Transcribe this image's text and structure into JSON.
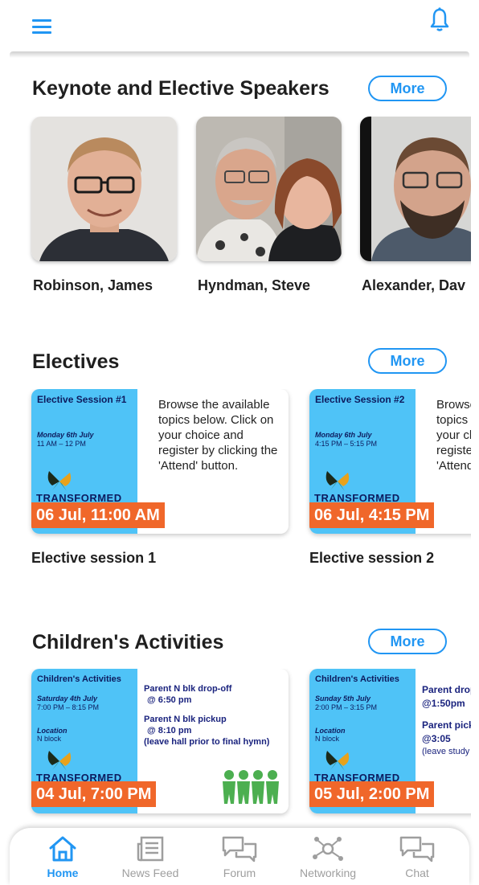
{
  "header": {
    "menu_icon": "hamburger-menu-icon",
    "notification_icon": "bell-icon",
    "accent_color": "#2196f3"
  },
  "speakers": {
    "title": "Keynote and Elective Speakers",
    "more_label": "More",
    "items": [
      {
        "name": "Robinson, James"
      },
      {
        "name": "Hyndman, Steve"
      },
      {
        "name": "Alexander, Dav"
      }
    ]
  },
  "electives": {
    "title": "Electives",
    "more_label": "More",
    "items": [
      {
        "banner_title": "Elective Session #1",
        "banner_day": "Monday 6th July",
        "banner_time": "11 AM – 12 PM",
        "brand": "TRANSFORMED",
        "description": "Browse the available topics below. Click on your choice and register by clicking the 'Attend' button.",
        "date_badge": "06 Jul, 11:00 AM",
        "title": "Elective session 1"
      },
      {
        "banner_title": "Elective Session #2",
        "banner_day": "Monday 6th July",
        "banner_time": "4:15 PM – 5:15 PM",
        "brand": "TRANSFORMED",
        "description": "Browse the available topics below. Click on your choice and register by clicking the 'Attend' button.",
        "date_badge": "06 Jul, 4:15 PM",
        "title": "Elective session 2"
      }
    ]
  },
  "children": {
    "title": "Children's Activities",
    "more_label": "More",
    "items": [
      {
        "banner_title": "Children's Activities",
        "banner_day": "Saturday 4th July",
        "banner_time": "7:00 PM – 8:15 PM",
        "location_label": "Location",
        "location_value": "N block",
        "brand": "TRANSFORMED",
        "line1": "Parent N blk drop-off",
        "line2": "@ 6:50 pm",
        "line3": "Parent N blk pickup",
        "line4": "@ 8:10 pm",
        "line5": "(leave hall prior to final hymn)",
        "date_badge": "04 Jul, 7:00 PM"
      },
      {
        "banner_title": "Children's Activities",
        "banner_day": "Sunday 5th July",
        "banner_time": "2:00 PM – 3:15 PM",
        "location_label": "Location",
        "location_value": "N block",
        "brand": "TRANSFORMED",
        "line1": "Parent drop-off",
        "line2": "@1:50pm",
        "line3": "Parent pickup",
        "line4": "@3:05",
        "line5": "(leave study prior to final hymn)",
        "date_badge": "05 Jul, 2:00 PM"
      }
    ]
  },
  "tabbar": {
    "active_color": "#2196f3",
    "inactive_color": "#9e9e9e",
    "tabs": [
      {
        "label": "Home",
        "icon": "home-icon"
      },
      {
        "label": "News Feed",
        "icon": "newspaper-icon"
      },
      {
        "label": "Forum",
        "icon": "forum-chat-icon"
      },
      {
        "label": "Networking",
        "icon": "network-icon"
      },
      {
        "label": "Chat",
        "icon": "chat-icon"
      }
    ]
  }
}
